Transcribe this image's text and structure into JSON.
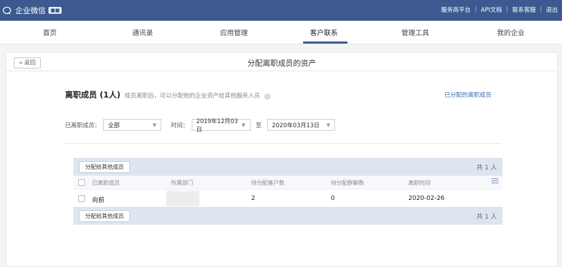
{
  "topbar": {
    "app_name": "企业微信",
    "badge": "■■",
    "links": [
      "服务商平台",
      "API文档",
      "联系客服",
      "退出"
    ]
  },
  "nav": {
    "items": [
      "首页",
      "通讯录",
      "应用管理",
      "客户联系",
      "管理工具",
      "我的企业"
    ],
    "active_index": 3
  },
  "panel": {
    "back_label": "« 返回",
    "title": "分配离职成员的资产"
  },
  "section": {
    "title": "离职成员 (1人)",
    "desc": "成员离职后，可以分配他的企业资产给其他服务人员",
    "assigned_link": "已分配的离职成员"
  },
  "filters": {
    "member_label": "已离职成员：",
    "member_value": "全部",
    "time_label": "时间：",
    "date_from": "2019年12月03日",
    "to_label": "至",
    "date_to": "2020年03月13日"
  },
  "table": {
    "assign_button": "分配给其他成员",
    "total": "共 1 人",
    "columns": [
      "已离职成员",
      "所属部门",
      "待分配客户数",
      "待分配群聊数",
      "离职时间"
    ],
    "rows": [
      {
        "name": "向前",
        "department": "",
        "customers": "2",
        "groups": "0",
        "date": "2020-02-26"
      }
    ]
  },
  "colors": {
    "topbar": "#3c5a8f",
    "link": "#3b6bb5",
    "table_bar": "#dde6f0"
  }
}
